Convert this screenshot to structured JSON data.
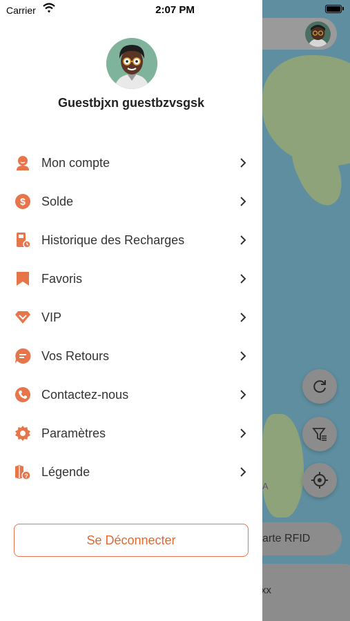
{
  "status_bar": {
    "carrier": "Carrier",
    "time": "2:07 PM"
  },
  "profile": {
    "name": "Guestbjxn guestbzvsgsk"
  },
  "menu": {
    "items": [
      {
        "label": "Mon compte",
        "icon": "person-icon"
      },
      {
        "label": "Solde",
        "icon": "dollar-coin-icon"
      },
      {
        "label": "Historique des Recharges",
        "icon": "recharge-history-icon"
      },
      {
        "label": "Favoris",
        "icon": "bookmark-icon"
      },
      {
        "label": "VIP",
        "icon": "vip-diamond-icon"
      },
      {
        "label": "Vos Retours",
        "icon": "feedback-chat-icon"
      },
      {
        "label": "Contactez-nous",
        "icon": "phone-icon"
      },
      {
        "label": "Paramètres",
        "icon": "gear-icon"
      },
      {
        "label": "Légende",
        "icon": "legend-map-icon"
      }
    ]
  },
  "logout_button": {
    "label": "Se Déconnecter"
  },
  "background": {
    "rfid_button_partial": "arte RFID",
    "bottom_card_partial": "xx",
    "map_partial_label": "A"
  },
  "colors": {
    "accent": "#e8744a",
    "text": "#333333",
    "chevron": "#333333"
  }
}
